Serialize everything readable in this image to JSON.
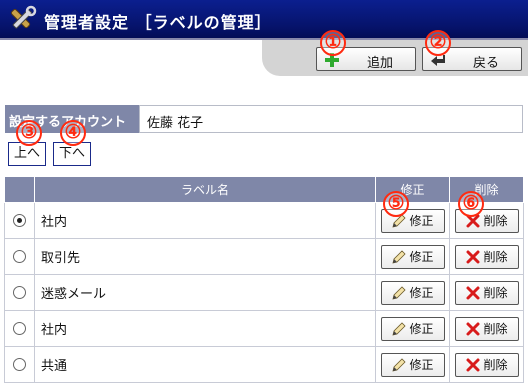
{
  "header": {
    "title": "管理者設定 ［ラベルの管理］",
    "icon": "tools-icon"
  },
  "toolbar": {
    "add_label": "追加",
    "back_label": "戻る"
  },
  "account": {
    "label": "設定するアカウント",
    "value": "佐藤 花子"
  },
  "move": {
    "up_label": "上へ",
    "down_label": "下へ"
  },
  "table": {
    "headers": {
      "name": "ラベル名",
      "edit": "修正",
      "delete": "削除"
    },
    "rows": [
      {
        "name": "社内",
        "selected": true,
        "edit_label": "修正",
        "delete_label": "削除"
      },
      {
        "name": "取引先",
        "selected": false,
        "edit_label": "修正",
        "delete_label": "削除"
      },
      {
        "name": "迷惑メール",
        "selected": false,
        "edit_label": "修正",
        "delete_label": "削除"
      },
      {
        "name": "社内",
        "selected": false,
        "edit_label": "修正",
        "delete_label": "削除"
      },
      {
        "name": "共通",
        "selected": false,
        "edit_label": "修正",
        "delete_label": "削除"
      }
    ]
  },
  "callouts": [
    "①",
    "②",
    "③",
    "④",
    "⑤",
    "⑥"
  ],
  "colors": {
    "header_bg": "#06136b",
    "label_bg": "#7f87a8",
    "callout": "#ff2a10",
    "delete_x": "#d81b1b",
    "add_plus": "#2faa2f"
  }
}
